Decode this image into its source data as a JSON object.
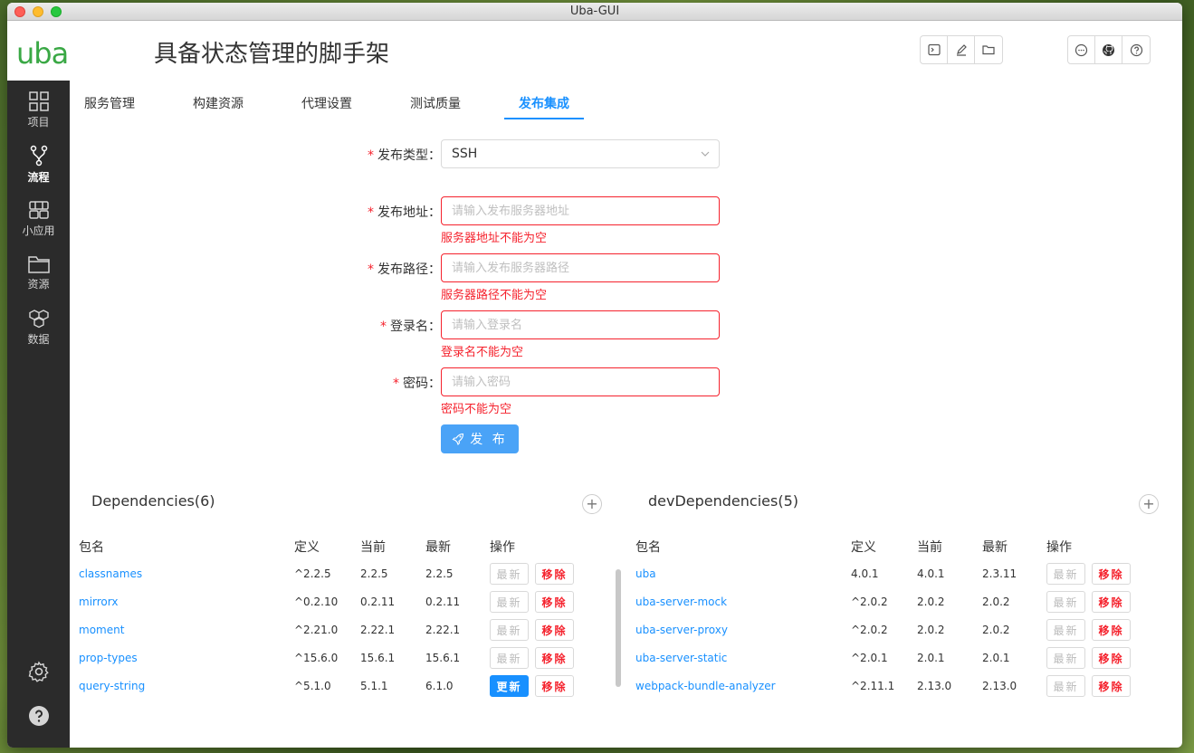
{
  "window": {
    "title": "Uba-GUI"
  },
  "header": {
    "logo": "uba",
    "title": "具备状态管理的脚手架",
    "tools_left": [
      "terminal-icon",
      "edit-icon",
      "folder-icon"
    ],
    "tools_right": [
      "chat-icon",
      "github-icon",
      "help-icon"
    ]
  },
  "sidebar": {
    "items": [
      {
        "label": "项目",
        "icon": "grid-icon"
      },
      {
        "label": "流程",
        "icon": "branch-icon",
        "active": true
      },
      {
        "label": "小应用",
        "icon": "apps-icon"
      },
      {
        "label": "资源",
        "icon": "folder-icon"
      },
      {
        "label": "数据",
        "icon": "cubes-icon"
      }
    ],
    "bottom": [
      "settings-icon",
      "help-icon"
    ]
  },
  "tabs": [
    "服务管理",
    "构建资源",
    "代理设置",
    "测试质量",
    "发布集成"
  ],
  "active_tab": "发布集成",
  "form": {
    "type": {
      "label": "发布类型",
      "value": "SSH"
    },
    "address": {
      "label": "发布地址",
      "placeholder": "请输入发布服务器地址",
      "error": "服务器地址不能为空"
    },
    "path": {
      "label": "发布路径",
      "placeholder": "请输入发布服务器路径",
      "error": "服务器路径不能为空"
    },
    "username": {
      "label": "登录名",
      "placeholder": "请输入登录名",
      "error": "登录名不能为空"
    },
    "password": {
      "label": "密码",
      "placeholder": "请输入密码",
      "error": "密码不能为空"
    },
    "submit": "发 布",
    "colon": "："
  },
  "dependencies": {
    "title": "Dependencies(6)",
    "columns": [
      "包名",
      "定义",
      "当前",
      "最新",
      "操作"
    ],
    "rows": [
      {
        "name": "classnames",
        "def": "^2.2.5",
        "cur": "2.2.5",
        "latest": "2.2.5",
        "update": false
      },
      {
        "name": "mirrorx",
        "def": "^0.2.10",
        "cur": "0.2.11",
        "latest": "0.2.11",
        "update": false
      },
      {
        "name": "moment",
        "def": "^2.21.0",
        "cur": "2.22.1",
        "latest": "2.22.1",
        "update": false
      },
      {
        "name": "prop-types",
        "def": "^15.6.0",
        "cur": "15.6.1",
        "latest": "15.6.1",
        "update": false
      },
      {
        "name": "query-string",
        "def": "^5.1.0",
        "cur": "5.1.1",
        "latest": "6.1.0",
        "update": true
      }
    ]
  },
  "devDependencies": {
    "title": "devDependencies(5)",
    "columns": [
      "包名",
      "定义",
      "当前",
      "最新",
      "操作"
    ],
    "rows": [
      {
        "name": "uba",
        "def": "4.0.1",
        "cur": "4.0.1",
        "latest": "2.3.11",
        "update": false
      },
      {
        "name": "uba-server-mock",
        "def": "^2.0.2",
        "cur": "2.0.2",
        "latest": "2.0.2",
        "update": false
      },
      {
        "name": "uba-server-proxy",
        "def": "^2.0.2",
        "cur": "2.0.2",
        "latest": "2.0.2",
        "update": false
      },
      {
        "name": "uba-server-static",
        "def": "^2.0.1",
        "cur": "2.0.1",
        "latest": "2.0.1",
        "update": false
      },
      {
        "name": "webpack-bundle-analyzer",
        "def": "^2.11.1",
        "cur": "2.13.0",
        "latest": "2.13.0",
        "update": false
      }
    ]
  },
  "buttons": {
    "update": "更新",
    "remove": "移除",
    "latest": "最新"
  },
  "colors": {
    "primary": "#1890ff",
    "error": "#f5222d",
    "logo": "#3aa845",
    "sidebar": "#2b2b2b"
  }
}
